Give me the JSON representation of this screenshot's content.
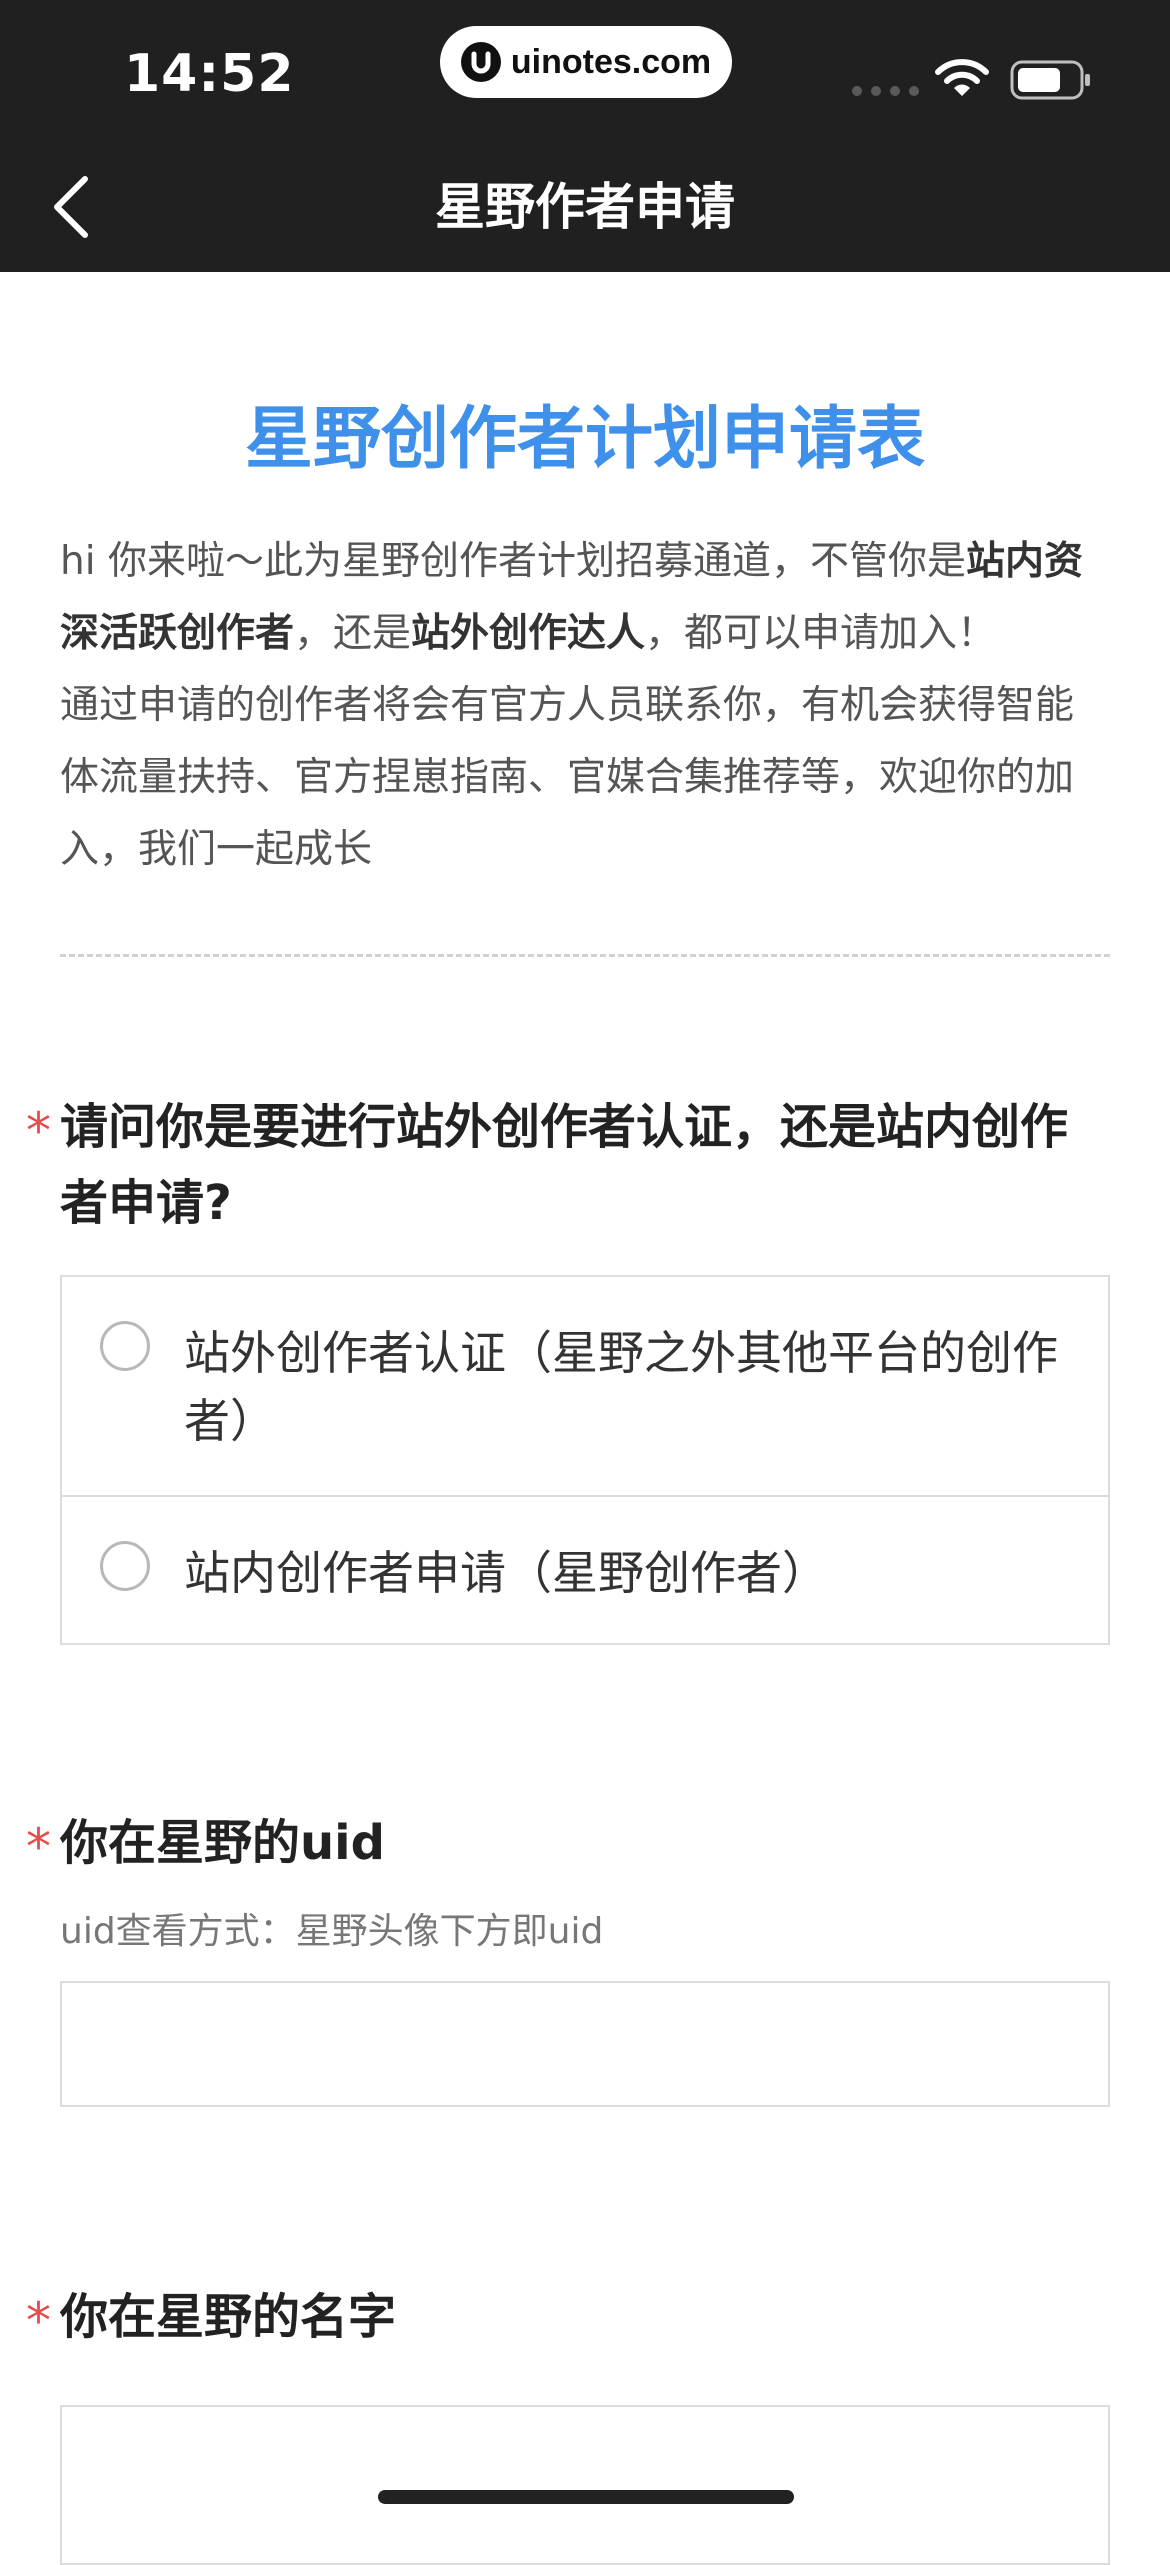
{
  "status_bar": {
    "time": "14:52",
    "url": "uinotes.com"
  },
  "nav": {
    "title": "星野作者申请"
  },
  "form": {
    "title": "星野创作者计划申请表",
    "intro": {
      "p1_a": "hi 你来啦～此为星野创作者计划招募通道，不管你是",
      "p1_bold1": "站内资深活跃创作者",
      "p1_b": "，还是",
      "p1_bold2": "站外创作达人",
      "p1_c": "，都可以申请加入！",
      "p2": "通过申请的创作者将会有官方人员联系你，有机会获得智能体流量扶持、官方捏崽指南、官媒合集推荐等，欢迎你的加入，我们一起成长"
    },
    "required_mark": "*",
    "q1": {
      "label": "请问你是要进行站外创作者认证，还是站内创作者申请?",
      "options": [
        "站外创作者认证（星野之外其他平台的创作者）",
        "站内创作者申请（星野创作者）"
      ]
    },
    "q2": {
      "label": "你在星野的uid",
      "hint": "uid查看方式：星野头像下方即uid",
      "value": ""
    },
    "q3": {
      "label": "你在星野的名字",
      "value": ""
    }
  }
}
